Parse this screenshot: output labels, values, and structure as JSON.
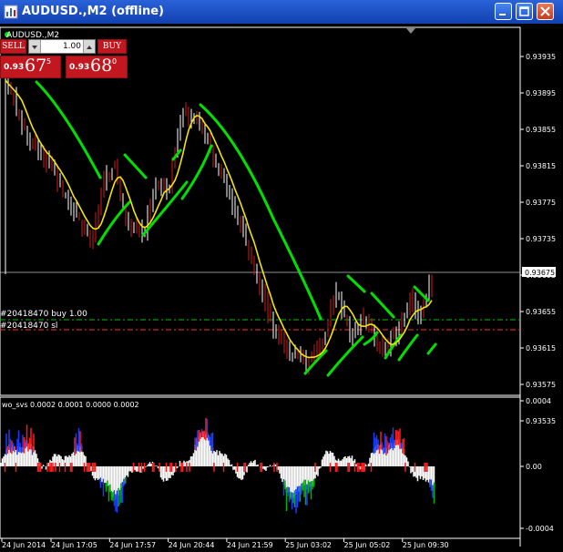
{
  "window": {
    "title": "AUDUSD.,M2 (offline)"
  },
  "chart": {
    "symbol_label": "AUDUSD.,M2"
  },
  "one_click": {
    "sell_label": "SELL",
    "buy_label": "BUY",
    "lot": "1.00",
    "bid_prefix": "0.93",
    "bid_big": "67",
    "bid_sup": "5",
    "ask_prefix": "0.93",
    "ask_big": "68",
    "ask_sup": "0"
  },
  "order_lines": {
    "buy_label": "#20418470 buy 1.00",
    "sl_label": "#20418470 sl"
  },
  "price_axis": {
    "ticks": [
      "0.93935",
      "0.93895",
      "0.93855",
      "0.93815",
      "0.93775",
      "0.93735",
      "0.93695",
      "0.93655",
      "0.93615",
      "0.93575",
      "0.93535"
    ],
    "current": "0.93675"
  },
  "indicator": {
    "label": "wo_svs 0.0002 0.0001 0.0000 0.0002",
    "ticks": [
      "0.0004",
      "0.00",
      "-0.0004"
    ]
  },
  "time_axis": {
    "ticks": [
      "24 Jun 2014",
      "24 Jun 17:05",
      "24 Jun 17:57",
      "24 Jun 20:44",
      "24 Jun 21:59",
      "25 Jun 03:02",
      "25 Jun 05:02",
      "25 Jun 09:30"
    ]
  },
  "colors": {
    "title_bar": "#1a4fc6",
    "sell_buy": "#c2171e",
    "ma": "#f5e400",
    "bands": "#00e000",
    "candles": "#d41a1a",
    "hist_white": "#ffffff",
    "hist_red": "#ff1a1a",
    "hist_blue": "#1a3cff",
    "hist_green": "#00b000"
  }
}
